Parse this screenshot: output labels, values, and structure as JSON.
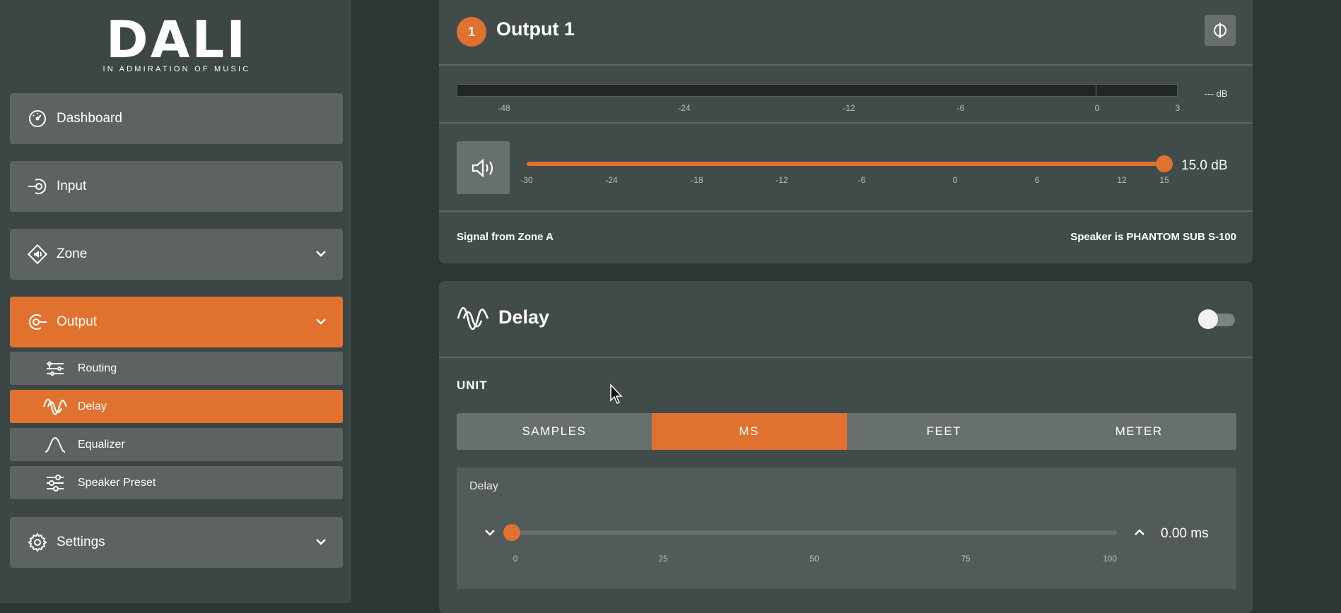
{
  "brand": {
    "name": "DALI",
    "tagline": "IN ADMIRATION OF MUSIC"
  },
  "sidebar": {
    "items": [
      {
        "label": "Dashboard",
        "icon": "gauge-icon",
        "expandable": false,
        "active": false
      },
      {
        "label": "Input",
        "icon": "input-icon",
        "expandable": false,
        "active": false
      },
      {
        "label": "Zone",
        "icon": "zone-speaker-icon",
        "expandable": true,
        "active": false
      },
      {
        "label": "Output",
        "icon": "output-icon",
        "expandable": true,
        "active": true
      },
      {
        "label": "Settings",
        "icon": "gear-icon",
        "expandable": true,
        "active": false
      }
    ],
    "output_subitems": [
      {
        "label": "Routing",
        "icon": "routing-icon",
        "active": false
      },
      {
        "label": "Delay",
        "icon": "wave-icon",
        "active": true
      },
      {
        "label": "Equalizer",
        "icon": "equalizer-curve-icon",
        "active": false
      },
      {
        "label": "Speaker Preset",
        "icon": "sliders-icon",
        "active": false
      }
    ]
  },
  "output": {
    "number": "1",
    "title": "Output 1",
    "phase_icon": "phase-invert-icon",
    "meter": {
      "value_label": "--- dB",
      "scale": [
        "-48",
        "-24",
        "-12",
        "-6",
        "0",
        "3"
      ]
    },
    "volume": {
      "icon": "speaker-volume-icon",
      "value": 15.0,
      "value_label": "15.0 dB",
      "min": -30,
      "max": 15,
      "scale": [
        "-30",
        "-24",
        "-18",
        "-12",
        "-6",
        "0",
        "6",
        "12",
        "15"
      ]
    },
    "signal_text": "Signal from Zone A",
    "speaker_text": "Speaker is PHANTOM SUB S-100"
  },
  "delay": {
    "title": "Delay",
    "icon": "wave-icon",
    "enabled": false,
    "unit_label": "UNIT",
    "units": [
      "SAMPLES",
      "MS",
      "FEET",
      "METER"
    ],
    "selected_unit": "MS",
    "panel_label": "Delay",
    "value": 0,
    "value_label": "0.00 ms",
    "min": 0,
    "max": 100,
    "scale": [
      "0",
      "25",
      "50",
      "75",
      "100"
    ]
  },
  "colors": {
    "accent": "#e0712e",
    "background": "#2d3634",
    "sidebar": "#3c4645",
    "card": "#414b4a",
    "button": "#5d6362"
  }
}
